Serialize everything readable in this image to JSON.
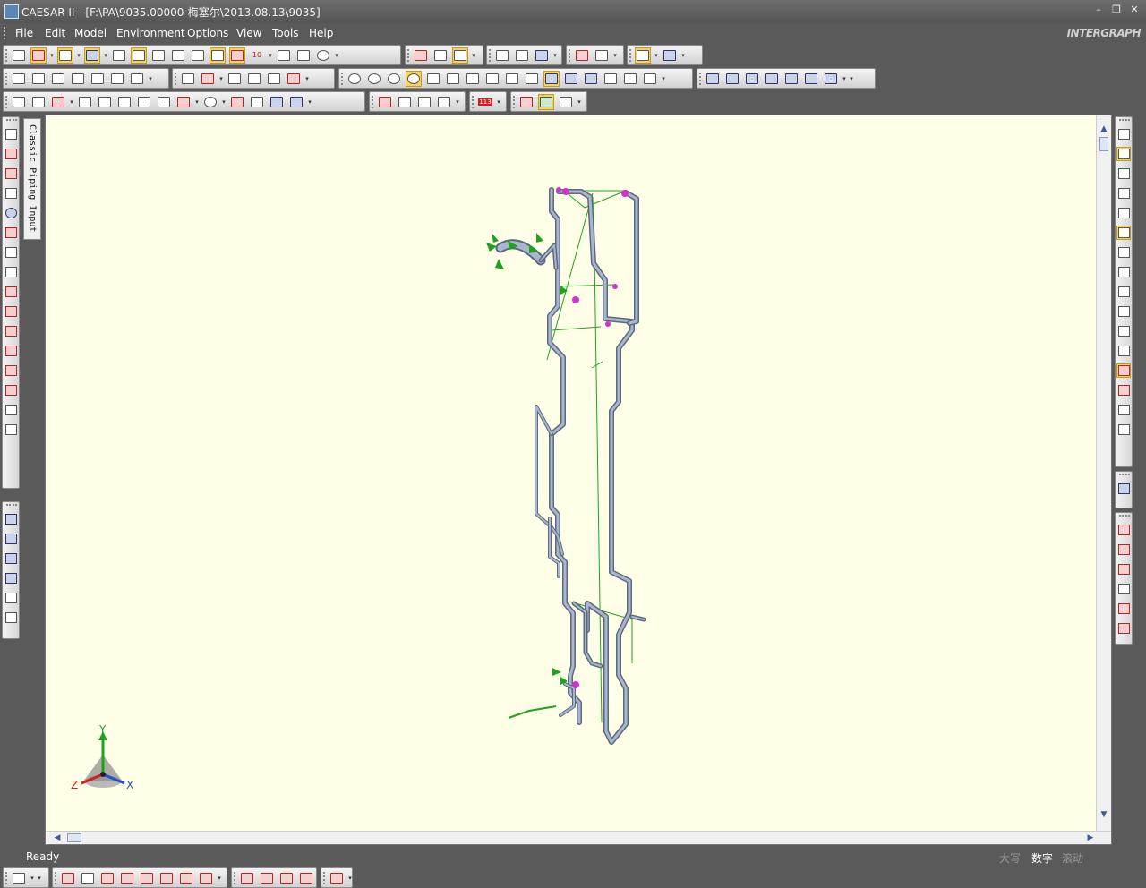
{
  "window": {
    "title": "CAESAR II - [F:\\PA\\9035.00000-梅塞尔\\2013.08.13\\9035]",
    "controls": [
      "–",
      "❐",
      "✕"
    ]
  },
  "menu": {
    "items": [
      "File",
      "Edit",
      "Model",
      "Environment",
      "Options",
      "View",
      "Tools",
      "Help"
    ],
    "brand": "INTERGRAPH"
  },
  "side_tab": {
    "label": "Classic Piping Input"
  },
  "statusbar": {
    "text": "Ready",
    "indicators": [
      {
        "label": "大写",
        "active": false
      },
      {
        "label": "数字",
        "active": true
      },
      {
        "label": "滚动",
        "active": false
      }
    ]
  },
  "axis_triad": {
    "x": "X",
    "y": "Y",
    "z": "Z"
  },
  "toolbar_extras": {
    "badge_10": "10",
    "badge_113": "113"
  },
  "colors": {
    "viewport_bg": "#ffffe7",
    "pipe": "#8f9db5",
    "restraint_green": "#1fa31f",
    "node_magenta": "#d233c9",
    "highlight": "#f7d25c"
  }
}
